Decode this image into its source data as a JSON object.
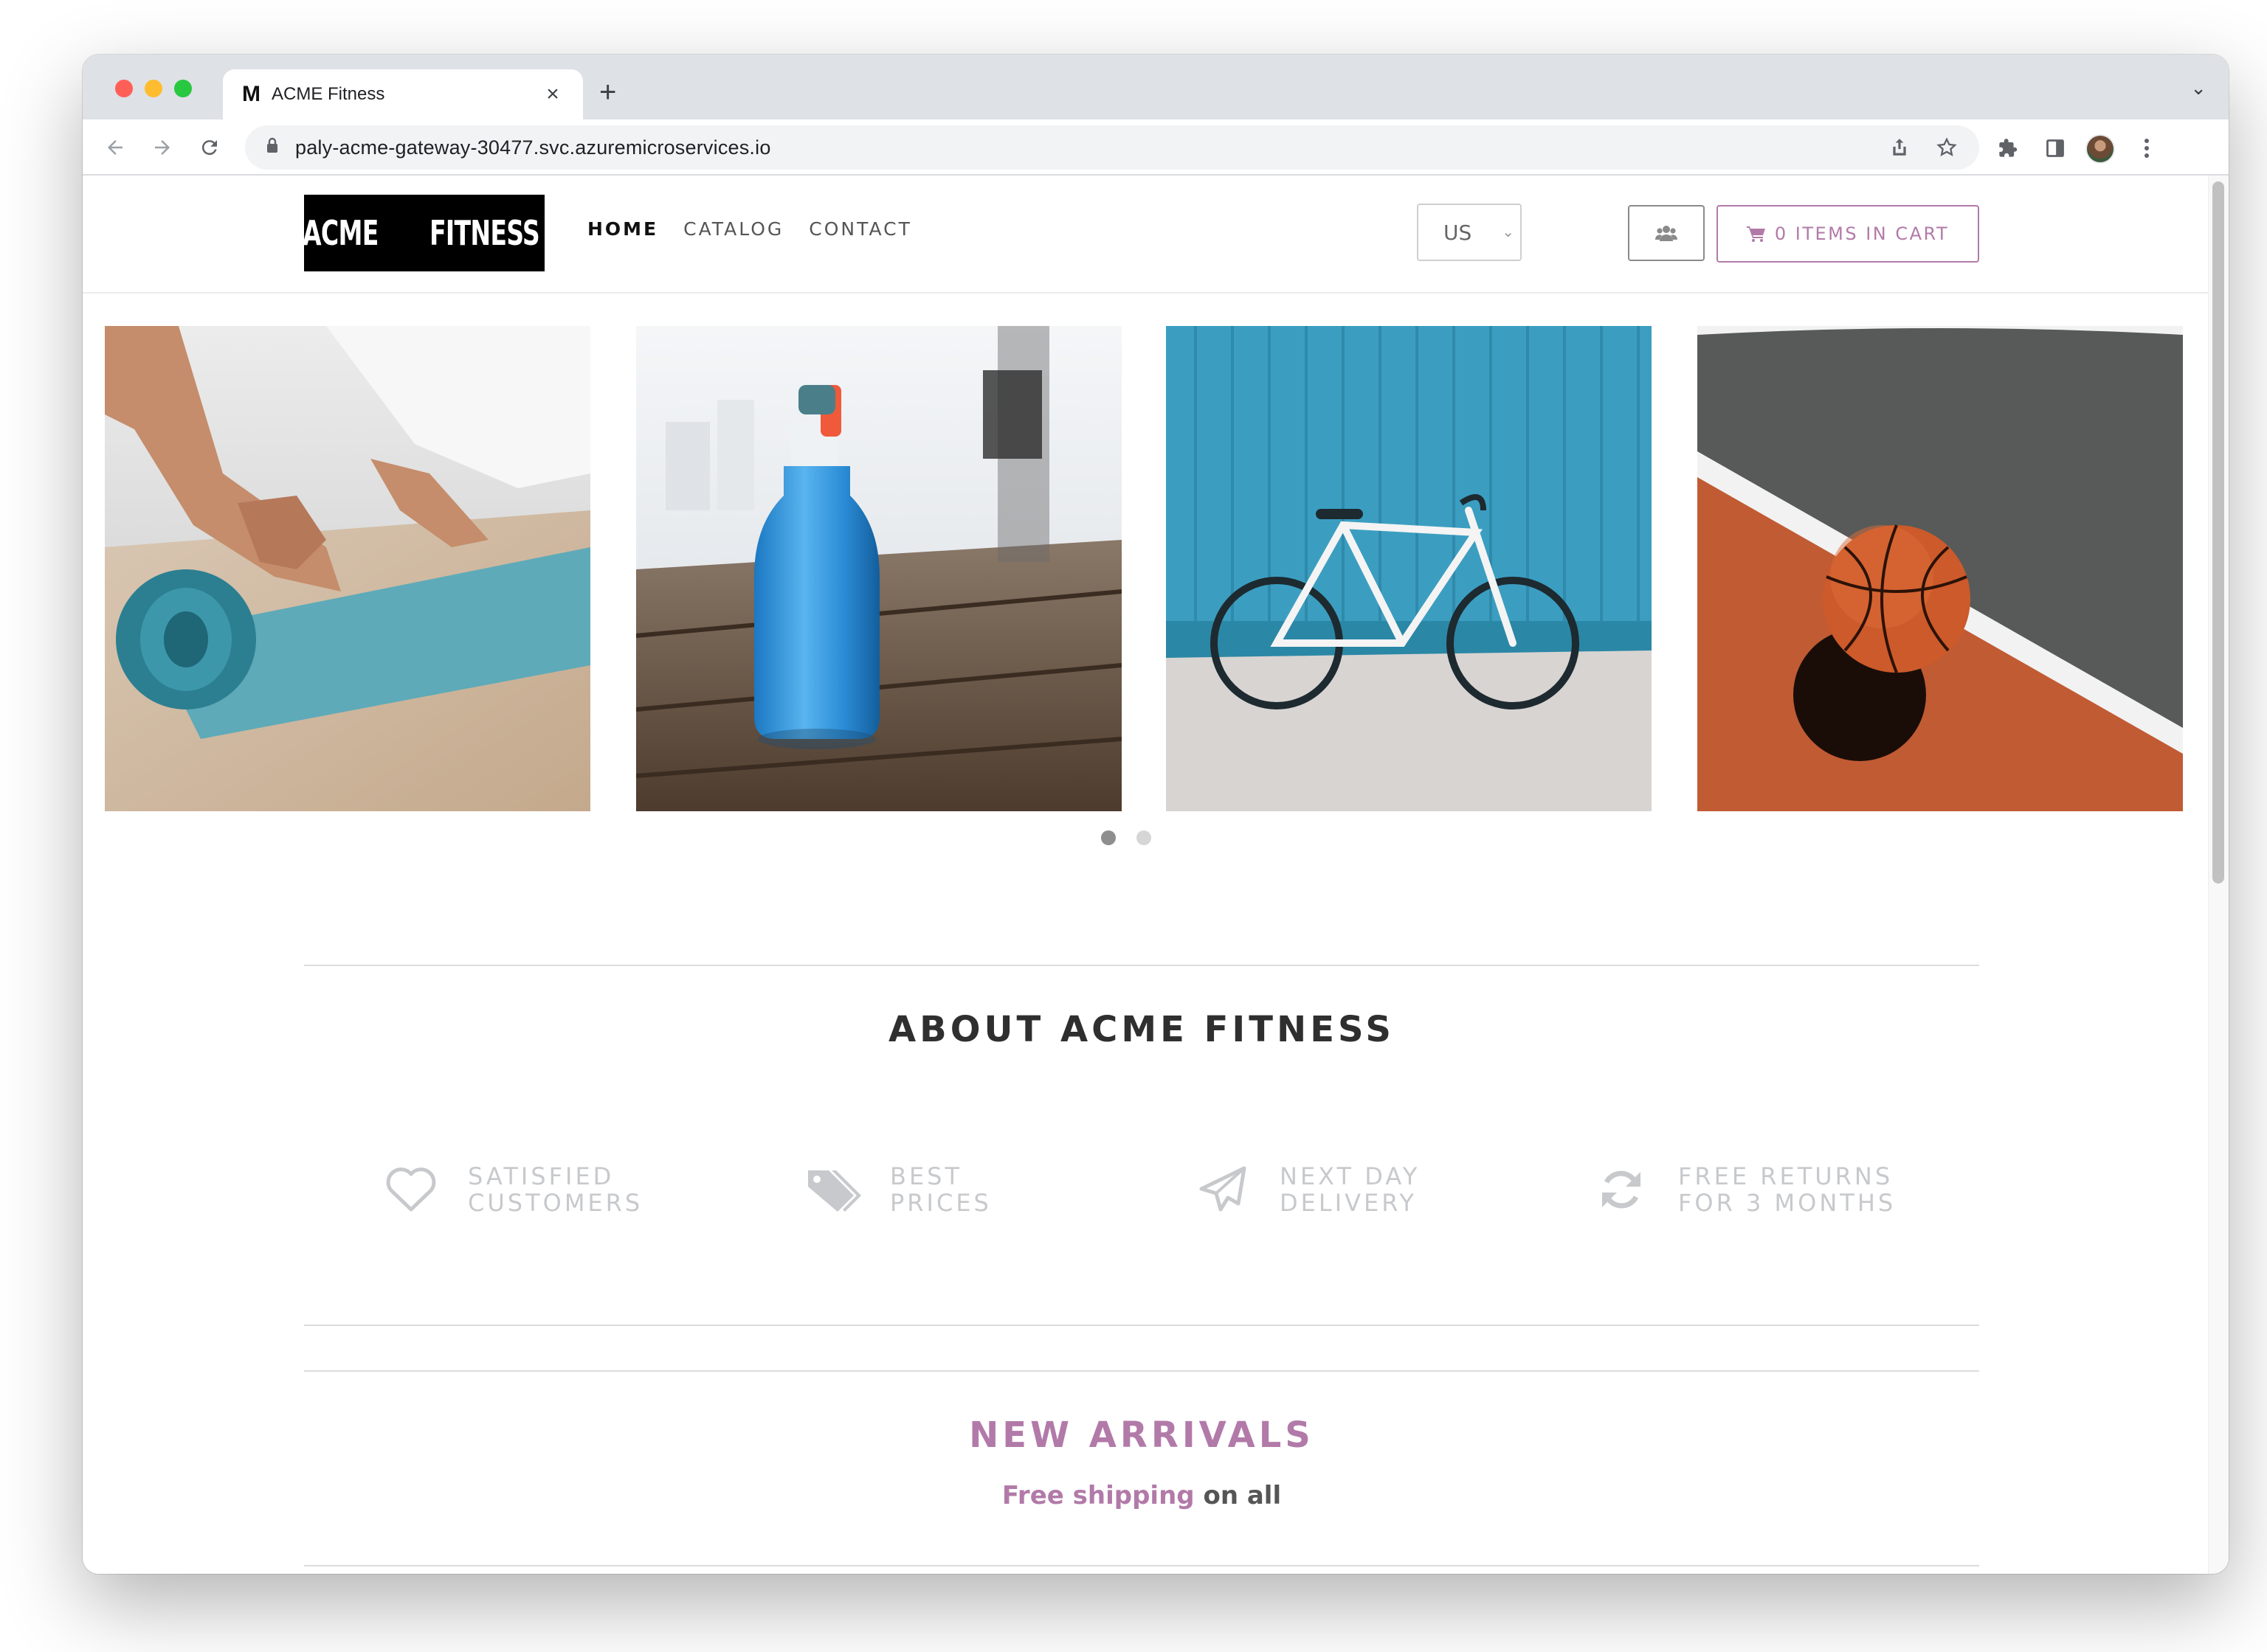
{
  "browser": {
    "tab_title": "ACME Fitness",
    "tab_favicon": "M",
    "new_tab_label": "+",
    "close_tab_label": "×",
    "url": "paly-acme-gateway-30477.svc.azuremicroservices.io",
    "icons": [
      "back-icon",
      "forward-icon",
      "reload-icon",
      "lock-icon",
      "share-icon",
      "bookmark-star-icon",
      "extensions-icon",
      "side-panel-icon",
      "profile-avatar",
      "menu-kebab-icon",
      "tab-list-chevron-icon"
    ]
  },
  "header": {
    "logo_left": "ACME",
    "logo_right": "FITNESS",
    "nav": [
      {
        "label": "HOME",
        "active": true
      },
      {
        "label": "CATALOG",
        "active": false
      },
      {
        "label": "CONTACT",
        "active": false
      }
    ],
    "country": "US",
    "user_icon": "users-icon",
    "cart_icon": "shopping-cart-icon",
    "cart_label": "0 ITEMS IN CART"
  },
  "carousel": {
    "slides": [
      "yoga-mat-image",
      "water-bottle-image",
      "bicycle-image",
      "basketball-image"
    ],
    "dot_count": 2,
    "active_dot": 0
  },
  "about": {
    "title": "ABOUT ACME FITNESS",
    "features": [
      {
        "icon": "heart-icon",
        "text": "SATISFIED\nCUSTOMERS"
      },
      {
        "icon": "tags-icon",
        "text": "BEST\nPRICES"
      },
      {
        "icon": "paper-plane-icon",
        "text": "NEXT DAY\nDELIVERY"
      },
      {
        "icon": "refresh-icon",
        "text": "FREE RETURNS\nFOR 3 MONTHS"
      }
    ]
  },
  "arrivals": {
    "title": "NEW ARRIVALS",
    "subtitle_highlight": "Free shipping",
    "subtitle_rest": " on all"
  },
  "colors": {
    "accent": "#b27aa8",
    "feature_text": "#c7c9cc",
    "heading": "#2f2f2f"
  }
}
